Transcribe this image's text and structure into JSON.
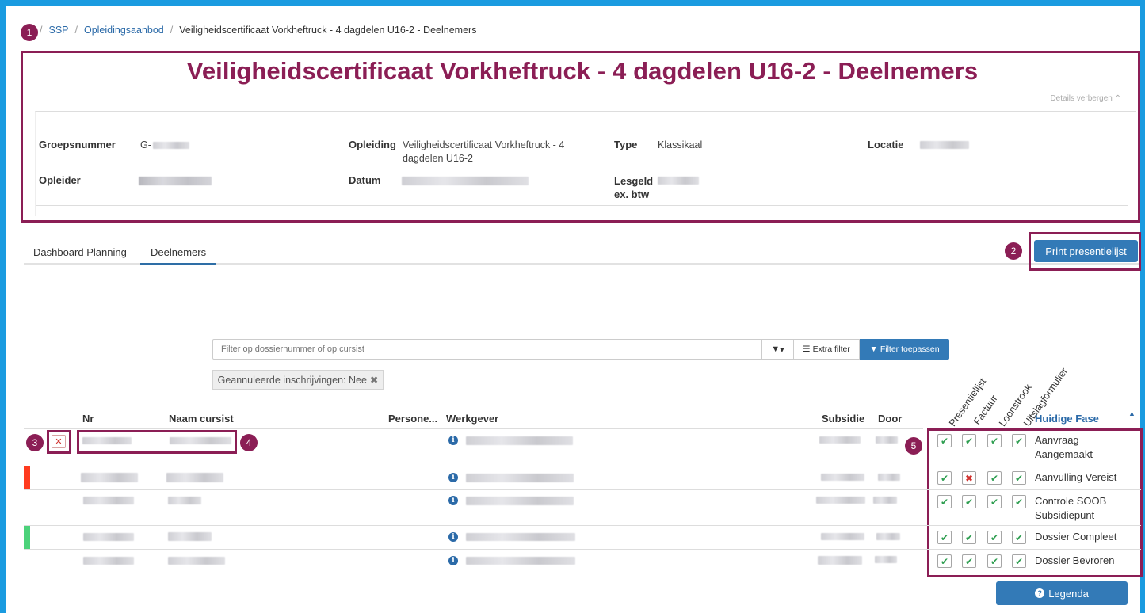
{
  "breadcrumb": {
    "items": [
      "SSP",
      "Opleidingsaanbod",
      "Veiligheidscertificaat Vorkheftruck - 4 dagdelen U16-2 - Deelnemers"
    ]
  },
  "page": {
    "title": "Veiligheidscertificaat Vorkheftruck - 4 dagdelen U16-2 - Deelnemers",
    "details_toggle": "Details verbergen"
  },
  "details": {
    "groepsnummer_label": "Groepsnummer",
    "groepsnummer_value": "G-",
    "opleiding_label": "Opleiding",
    "opleiding_value": "Veiligheidscertificaat Vorkheftruck - 4 dagdelen U16-2",
    "type_label": "Type",
    "type_value": "Klassikaal",
    "locatie_label": "Locatie",
    "opleider_label": "Opleider",
    "datum_label": "Datum",
    "lesgeld_label": "Lesgeld ex. btw"
  },
  "tabs": [
    {
      "label": "Dashboard Planning",
      "active": false
    },
    {
      "label": "Deelnemers",
      "active": true
    }
  ],
  "actions": {
    "print_label": "Print presentielijst",
    "legenda_label": "Legenda"
  },
  "filter": {
    "placeholder": "Filter op dossiernummer of op cursist",
    "funnel_label": "▾",
    "extra_filter_label": "Extra filter",
    "apply_label": "Filter toepassen",
    "active_chip": "Geannuleerde inschrijvingen: Nee"
  },
  "table": {
    "headers": {
      "nr": "Nr",
      "naam": "Naam cursist",
      "personeel": "Persone...",
      "werkgever": "Werkgever",
      "subsidie": "Subsidie",
      "door": "Door",
      "presentielijst": "Presentielijst",
      "factuur": "Factuur",
      "loonstrook": "Loonstrook",
      "uitslagformulier": "Uitslagformulier",
      "huidige_fase": "Huidige Fase"
    },
    "rows": [
      {
        "status_color": "",
        "checks": [
          "ok",
          "ok",
          "ok",
          "ok"
        ],
        "fase": "Aanvraag Aangemaakt"
      },
      {
        "status_color": "#ff3b1f",
        "checks": [
          "ok",
          "no",
          "ok",
          "ok"
        ],
        "fase": "Aanvulling Vereist"
      },
      {
        "status_color": "",
        "checks": [
          "ok",
          "ok",
          "ok",
          "ok"
        ],
        "fase": "Controle SOOB Subsidiepunt"
      },
      {
        "status_color": "#4cd27a",
        "checks": [
          "ok",
          "ok",
          "ok",
          "ok"
        ],
        "fase": "Dossier Compleet"
      },
      {
        "status_color": "",
        "checks": [
          "ok",
          "ok",
          "ok",
          "ok"
        ],
        "fase": "Dossier Bevroren"
      }
    ]
  },
  "markers": [
    "1",
    "2",
    "3",
    "4",
    "5"
  ],
  "colors": {
    "frame": "#1a9be0",
    "annotation": "#8b1e55",
    "primary": "#337ab7",
    "check_ok": "#2e9e50",
    "check_no": "#d0312d"
  }
}
